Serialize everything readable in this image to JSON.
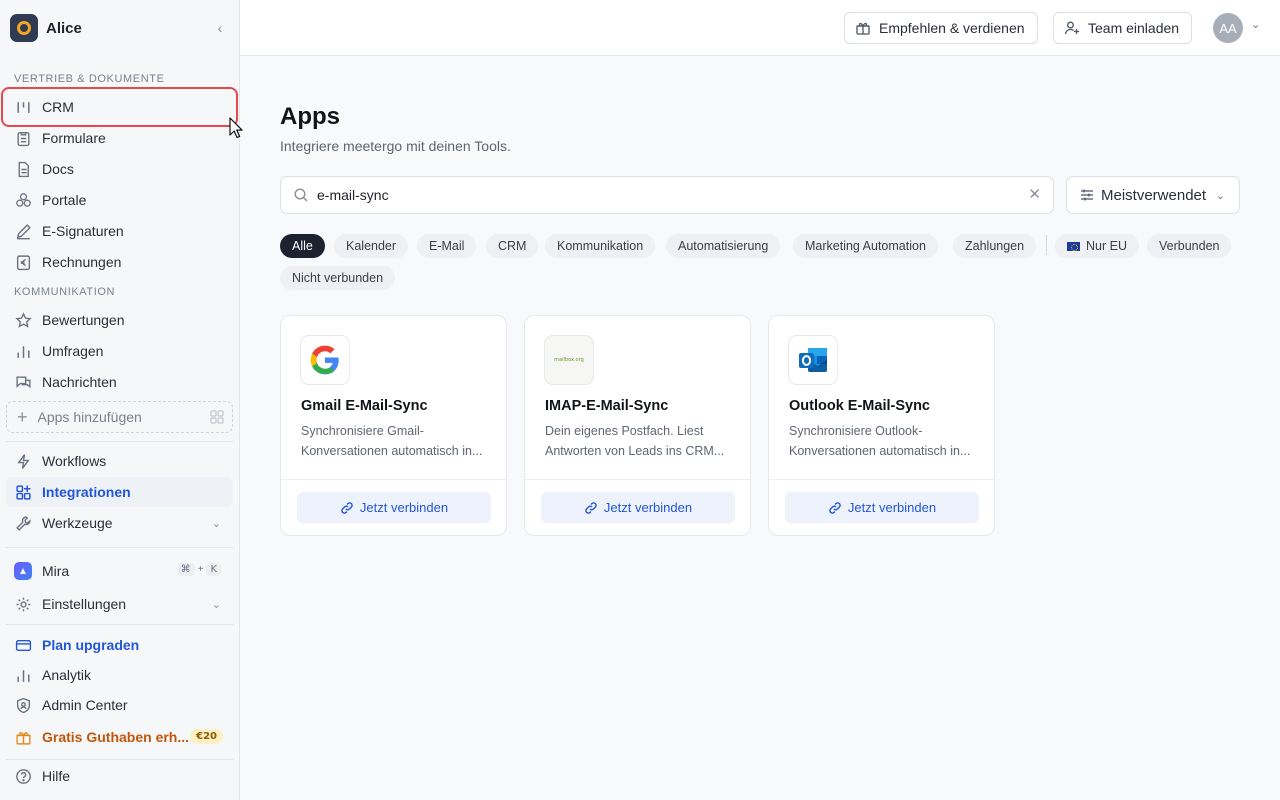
{
  "workspace": {
    "name": "Alice"
  },
  "sidebar": {
    "section_sales": "VERTRIEB & DOKUMENTE",
    "sales_items": [
      {
        "label": "CRM",
        "icon": "crm-icon"
      },
      {
        "label": "Formulare",
        "icon": "clipboard-icon"
      },
      {
        "label": "Docs",
        "icon": "document-icon"
      },
      {
        "label": "Portale",
        "icon": "cubes-icon"
      },
      {
        "label": "E-Signaturen",
        "icon": "pen-icon"
      },
      {
        "label": "Rechnungen",
        "icon": "invoice-euro-icon"
      }
    ],
    "section_comm": "KOMMUNIKATION",
    "comm_items": [
      {
        "label": "Bewertungen",
        "icon": "star-icon"
      },
      {
        "label": "Umfragen",
        "icon": "bar-chart-icon"
      },
      {
        "label": "Nachrichten",
        "icon": "chat-icon"
      }
    ],
    "add_apps": "Apps hinzufügen",
    "workflows": "Workflows",
    "integrations": "Integrationen",
    "tools": "Werkzeuge",
    "mira": "Mira",
    "mira_shortcut_mod": "⌘",
    "mira_shortcut_plus": "+",
    "mira_shortcut_key": "K",
    "settings": "Einstellungen",
    "plan_upgrade": "Plan upgraden",
    "analytics": "Analytik",
    "admin_center": "Admin Center",
    "free_credit": "Gratis Guthaben erh...",
    "free_credit_badge": "€20",
    "help": "Hilfe"
  },
  "topbar": {
    "refer": "Empfehlen & verdienen",
    "invite": "Team einladen",
    "avatar_initials": "AA"
  },
  "main": {
    "title": "Apps",
    "subtitle": "Integriere meetergo mit deinen Tools.",
    "search_value": "e-mail-sync",
    "sort_label": "Meistverwendet",
    "filters": [
      "Alle",
      "Kalender",
      "E-Mail",
      "CRM",
      "Kommunikation",
      "Automatisierung",
      "Marketing Automation",
      "Zahlungen",
      "Nur EU",
      "Verbunden",
      "Nicht verbunden"
    ],
    "cards": [
      {
        "name": "Gmail E-Mail-Sync",
        "desc_line1": "Synchronisiere Gmail-",
        "desc_line2": "Konversationen automatisch in...",
        "action": "Jetzt verbinden"
      },
      {
        "name": "IMAP-E-Mail-Sync",
        "desc_line1": "Dein eigenes Postfach. Liest",
        "desc_line2": "Antworten von Leads ins CRM...",
        "action": "Jetzt verbinden",
        "logo_text": "mailbox.org"
      },
      {
        "name": "Outlook E-Mail-Sync",
        "desc_line1": "Synchronisiere Outlook-",
        "desc_line2": "Konversationen automatisch in...",
        "action": "Jetzt verbinden"
      }
    ]
  },
  "colors": {
    "accent": "#2457d6",
    "highlight": "#e5484d",
    "chip_selected": "#1c2230"
  }
}
